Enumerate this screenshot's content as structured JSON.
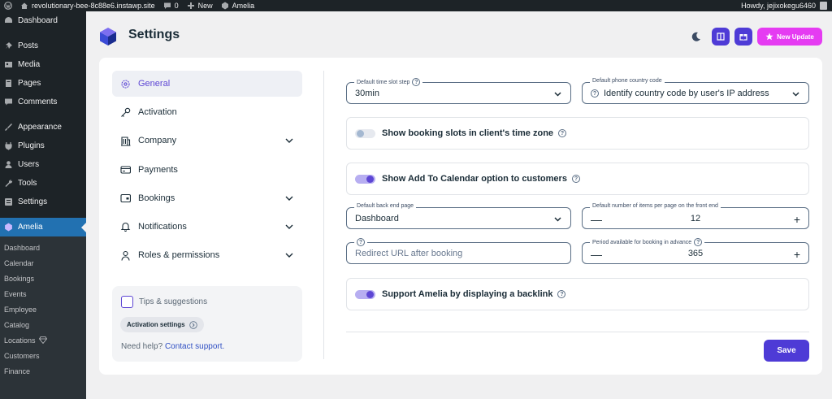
{
  "admin_bar": {
    "site_name": "revolutionary-bee-8c88e6.instawp.site",
    "comments_count": "0",
    "new_label": "New",
    "plugin_label": "Amelia",
    "howdy": "Howdy, jejixokegu6460"
  },
  "sidebar": {
    "items": [
      {
        "label": "Dashboard",
        "icon": "dashboard-icon"
      },
      {
        "label": "Posts",
        "icon": "pin-icon"
      },
      {
        "label": "Media",
        "icon": "media-icon"
      },
      {
        "label": "Pages",
        "icon": "pages-icon"
      },
      {
        "label": "Comments",
        "icon": "comment-icon"
      },
      {
        "label": "Appearance",
        "icon": "brush-icon"
      },
      {
        "label": "Plugins",
        "icon": "plug-icon"
      },
      {
        "label": "Users",
        "icon": "user-icon"
      },
      {
        "label": "Tools",
        "icon": "wrench-icon"
      },
      {
        "label": "Settings",
        "icon": "settings-icon"
      }
    ],
    "current": "Amelia",
    "submenu": [
      "Dashboard",
      "Calendar",
      "Bookings",
      "Events",
      "Employee",
      "Catalog",
      "Locations",
      "Customers",
      "Finance"
    ]
  },
  "header": {
    "title": "Settings",
    "new_update": "New Update"
  },
  "settings_nav": [
    {
      "label": "General",
      "icon": "gear-icon",
      "active": true,
      "chevron": false
    },
    {
      "label": "Activation",
      "icon": "key-icon",
      "active": false,
      "chevron": false
    },
    {
      "label": "Company",
      "icon": "building-icon",
      "active": false,
      "chevron": true
    },
    {
      "label": "Payments",
      "icon": "card-icon",
      "active": false,
      "chevron": false
    },
    {
      "label": "Bookings",
      "icon": "wallet-icon",
      "active": false,
      "chevron": true
    },
    {
      "label": "Notifications",
      "icon": "bell-icon",
      "active": false,
      "chevron": true
    },
    {
      "label": "Roles & permissions",
      "icon": "person-icon",
      "active": false,
      "chevron": true
    }
  ],
  "tips": {
    "title": "Tips & suggestions",
    "activation": "Activation settings",
    "help_text": "Need help?",
    "contact": "Contact support."
  },
  "form": {
    "time_slot": {
      "label": "Default time slot step",
      "value": "30min"
    },
    "phone_code": {
      "label": "Default phone country code",
      "value": "Identify country code by user's IP address"
    },
    "toggle_timezone": {
      "label": "Show booking slots in client's time zone",
      "on": false
    },
    "toggle_calendar": {
      "label": "Show Add To Calendar option to customers",
      "on": true
    },
    "back_end_page": {
      "label": "Default back end page",
      "value": "Dashboard"
    },
    "items_per_page": {
      "label": "Default number of items per page on the front end",
      "value": "12"
    },
    "redirect_url": {
      "placeholder": "Redirect URL after booking"
    },
    "period_booking": {
      "label": "Period available for booking in advance",
      "value": "365"
    },
    "toggle_backlink": {
      "label": "Support Amelia by displaying a backlink",
      "on": true
    }
  },
  "save_label": "Save",
  "colors": {
    "accent": "#5d46d4",
    "wp_blue": "#2271b1",
    "new_update": "#e53bf2",
    "save": "#4e3bd6"
  }
}
